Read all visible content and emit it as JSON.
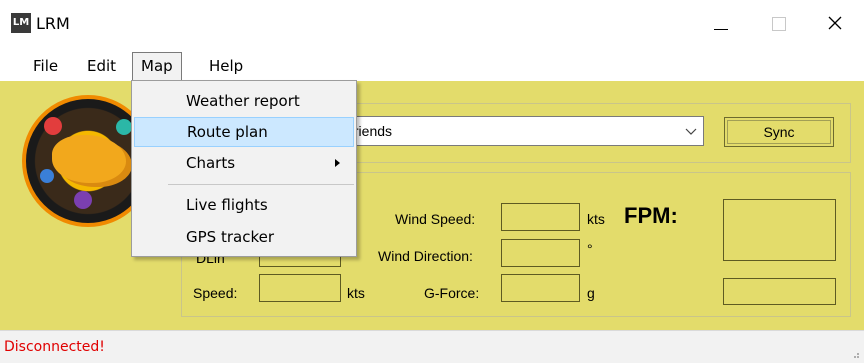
{
  "window": {
    "title": "LRM",
    "icon_text": "LM"
  },
  "menubar": {
    "items": [
      "File",
      "Edit",
      "Map",
      "Help"
    ]
  },
  "map_menu": {
    "items": [
      {
        "label": "Weather report",
        "selected": false,
        "submenu": false
      },
      {
        "label": "Route plan",
        "selected": true,
        "submenu": false
      },
      {
        "label": "Charts",
        "selected": false,
        "submenu": true
      },
      {
        "label": "Live flights",
        "selected": false,
        "submenu": false
      },
      {
        "label": "GPS tracker",
        "selected": false,
        "submenu": false
      }
    ]
  },
  "server_select": {
    "value": "friends",
    "icon": "chevron-down-icon"
  },
  "sync_button": {
    "label": "Sync"
  },
  "labels": {
    "wind_speed": "Wind Speed:",
    "wind_direction": "Wind Direction:",
    "speed": "Speed:",
    "g_force": "G-Force:",
    "fpm": "FPM:",
    "partial_left": "DLin"
  },
  "units": {
    "wind_speed": "kts",
    "wind_direction": "°",
    "speed": "kts",
    "g_force": "g"
  },
  "status": {
    "text": "Disconnected!"
  },
  "colors": {
    "form_bg": "#e3dc6b",
    "status_text": "#e00000",
    "selection": "#cce8ff"
  }
}
